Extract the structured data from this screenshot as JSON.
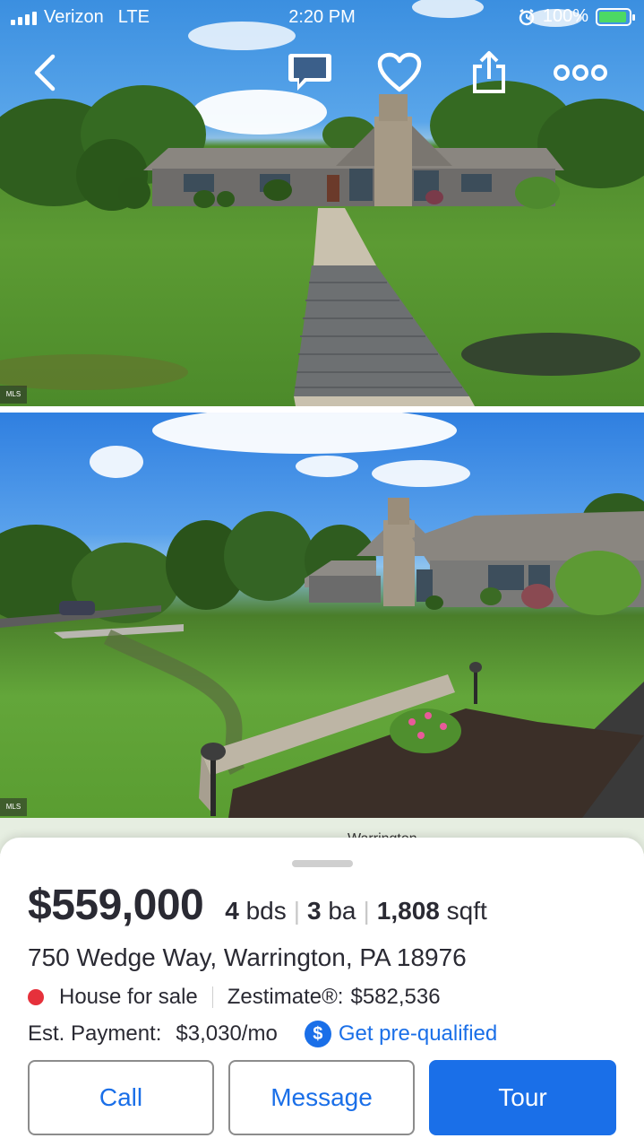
{
  "status_bar": {
    "carrier": "Verizon",
    "network": "LTE",
    "time": "2:20 PM",
    "battery": "100%"
  },
  "top_actions": {
    "back_icon": "chevron-left-icon",
    "comment_icon": "speech-bubble-icon",
    "save_icon": "heart-icon",
    "share_icon": "share-icon",
    "more_icon": "more-icon"
  },
  "photos": [
    {
      "description": "house-front-walkway",
      "badge": "MLS"
    },
    {
      "description": "house-side-lawn",
      "badge": "MLS"
    }
  ],
  "map": {
    "label": "Warrington"
  },
  "listing": {
    "price": "$559,000",
    "beds": "4",
    "beds_unit": "bds",
    "baths": "3",
    "baths_unit": "ba",
    "sqft": "1,808",
    "sqft_unit": "sqft",
    "address": "750 Wedge Way, Warrington, PA 18976",
    "status": "House for sale",
    "status_color": "#e6313b",
    "zestimate_label": "Zestimate®:",
    "zestimate_value": "$582,536",
    "payment_label": "Est. Payment:",
    "payment_value": "$3,030/mo",
    "prequal_label": "Get pre-qualified",
    "prequal_icon": "dollar-icon"
  },
  "actions": {
    "call": "Call",
    "message": "Message",
    "tour": "Tour"
  },
  "colors": {
    "accent": "#1a6fe8",
    "text": "#2a2a33"
  }
}
